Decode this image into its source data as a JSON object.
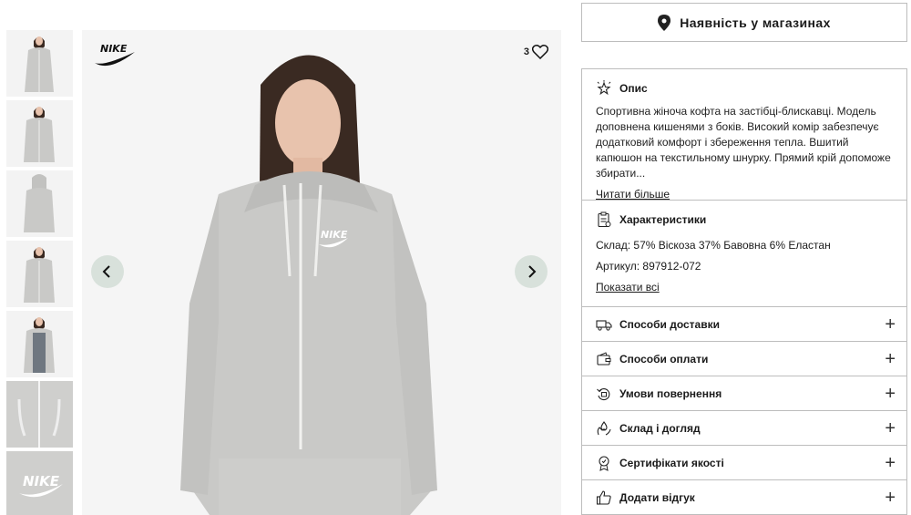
{
  "brand": "NIKE",
  "favorites": {
    "count": "3"
  },
  "thumbnails": [
    {
      "view": "front"
    },
    {
      "view": "front-2"
    },
    {
      "view": "back"
    },
    {
      "view": "front-3"
    },
    {
      "view": "open"
    },
    {
      "view": "detail-zipper"
    },
    {
      "view": "detail-logo"
    }
  ],
  "store_button": {
    "label": "Наявність у магазинах",
    "icon": "location-pin-icon"
  },
  "description": {
    "title": "Опис",
    "text": "Спортивна жіноча кофта на застібці-блискавці. Модель доповнена кишенями з боків. Високий комір забезпечує додатковий комфорт і збереження тепла. Вшитий капюшон на текстильному шнурку. Прямий крій допоможе збирати...",
    "more": "Читати більше"
  },
  "characteristics": {
    "title": "Характеристики",
    "composition": "Склад: 57% Віскоза 37% Бавовна 6% Еластан",
    "sku": "Артикул: 897912-072",
    "show_all": "Показати всі"
  },
  "accordion": [
    {
      "label": "Способи доставки",
      "icon": "truck-icon"
    },
    {
      "label": "Способи оплати",
      "icon": "wallet-icon"
    },
    {
      "label": "Умови повернення",
      "icon": "return-icon"
    },
    {
      "label": "Склад і догляд",
      "icon": "care-hands-icon"
    },
    {
      "label": "Сертифікати якості",
      "icon": "certificate-icon"
    },
    {
      "label": "Додати відгук",
      "icon": "thumbs-up-icon"
    }
  ],
  "colors": {
    "hoodie": "#c9c9c7",
    "hair": "#3a2a22",
    "skin": "#e8c3ad",
    "arrow_bg": "#d8e1db",
    "border": "#bdbdbd"
  }
}
